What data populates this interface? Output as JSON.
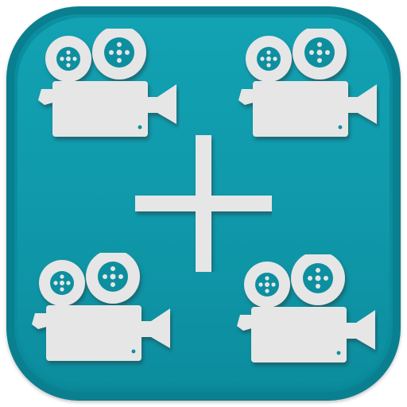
{
  "icon": {
    "icons": [
      "movie-camera-icon",
      "movie-camera-icon",
      "movie-camera-icon",
      "movie-camera-icon",
      "plus-icon"
    ],
    "colors": {
      "background": "#0a8fa0",
      "symbol": "#e6e6e6",
      "symbol_shadow": "#2b5f66",
      "reel_detail": "#0a8fa0"
    }
  }
}
